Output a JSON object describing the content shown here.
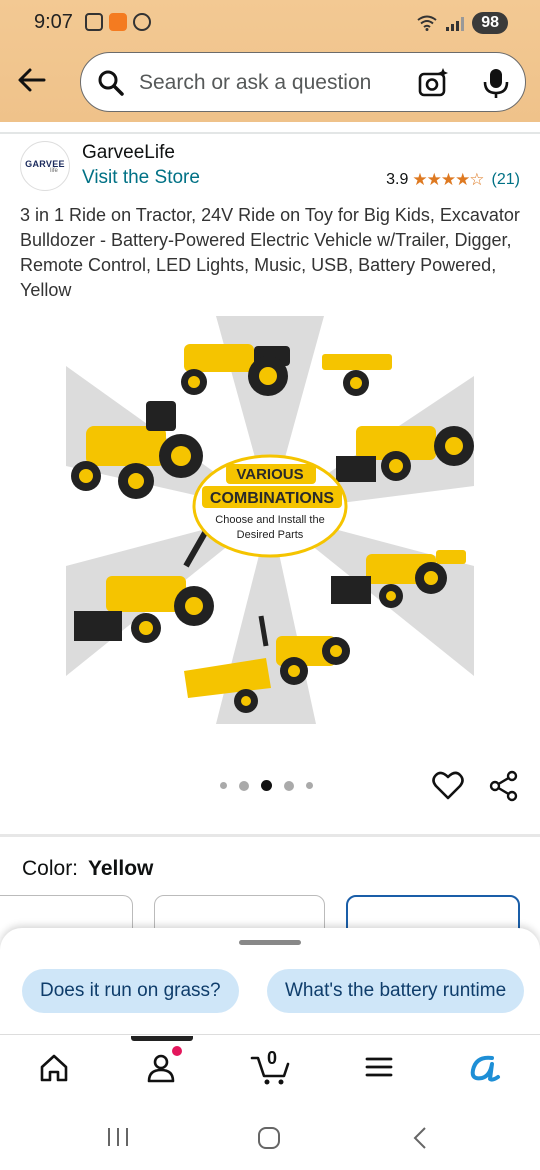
{
  "status_bar": {
    "time": "9:07",
    "battery": "98"
  },
  "search": {
    "placeholder": "Search or ask a question"
  },
  "seller": {
    "logo_text": "GARVEE",
    "logo_sub": "life",
    "name": "GarveeLife",
    "visit_label": "Visit the Store",
    "rating": "3.9",
    "stars": "★★★★☆",
    "review_count": "(21)"
  },
  "product": {
    "title": "3 in 1 Ride on Tractor, 24V Ride on Toy for Big Kids, Excavator Bulldozer - Battery-Powered Electric Vehicle w/Trailer, Digger, Remote Control, LED Lights, Music, USB, Battery Powered, Yellow",
    "image": {
      "badge_line1": "VARIOUS",
      "badge_line2": "COMBINATIONS",
      "caption_line1": "Choose and Install the",
      "caption_line2": "Desired Parts"
    },
    "carousel": {
      "count": 5,
      "active_index": 2
    }
  },
  "color": {
    "label": "Color:",
    "value": "Yellow"
  },
  "suggestions": [
    {
      "label": "Does it run on grass?"
    },
    {
      "label": "What's the battery runtime"
    }
  ],
  "nav": {
    "cart_count": "0"
  },
  "colors": {
    "header": "#f3c993",
    "link": "#007185",
    "star": "#de7921",
    "chip": "#cfe6f8",
    "accent": "#f5c400"
  },
  "icons": [
    "back-arrow-icon",
    "search-icon",
    "camera-icon",
    "mic-icon",
    "heart-icon",
    "share-icon",
    "home-icon",
    "profile-icon",
    "cart-icon",
    "menu-icon",
    "rufus-icon"
  ]
}
